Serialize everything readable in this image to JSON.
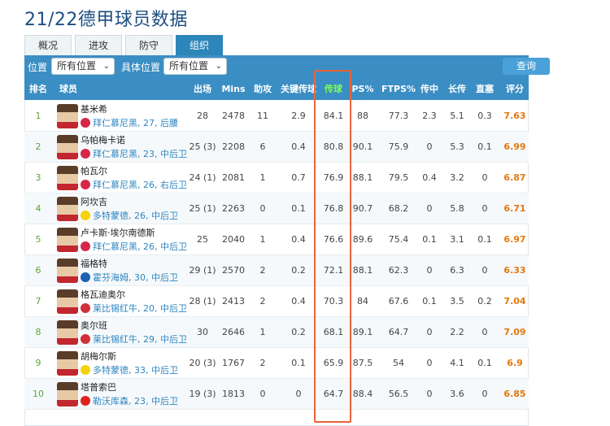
{
  "title": "21/22德甲球员数据",
  "tabs": [
    {
      "label": "概况"
    },
    {
      "label": "进攻"
    },
    {
      "label": "防守"
    },
    {
      "label": "组织"
    }
  ],
  "filters": {
    "position_label": "位置",
    "position_value": "所有位置",
    "detail_label": "具体位置",
    "detail_value": "所有位置",
    "query_label": "查询"
  },
  "columns": [
    "排名",
    "球员",
    "出场",
    "Mins",
    "助攻",
    "关键传球",
    "传球",
    "PS%",
    "FTPS%",
    "传中",
    "长传",
    "直塞",
    "评分"
  ],
  "club_colors": {
    "拜仁慕尼黑": "#d6264a",
    "多特蒙德": "#f5d20b",
    "霍芬海姆": "#1b62b5",
    "莱比锡红牛": "#d32e3b",
    "勒沃库森": "#e02020"
  },
  "players": [
    {
      "rank": "1",
      "name": "基米希",
      "info": "拜仁慕尼黑, 27, 后腰",
      "club": "拜仁慕尼黑",
      "apps": "28",
      "mins": "2478",
      "assists": "11",
      "key_passes": "2.9",
      "passes": "84.1",
      "ps": "88",
      "ftps": "77.3",
      "crosses": "2.3",
      "long": "5.1",
      "through": "0.3",
      "rating": "7.63"
    },
    {
      "rank": "2",
      "name": "乌帕梅卡诺",
      "info": "拜仁慕尼黑, 23, 中后卫",
      "club": "拜仁慕尼黑",
      "apps": "25 (3)",
      "mins": "2208",
      "assists": "6",
      "key_passes": "0.4",
      "passes": "80.8",
      "ps": "90.1",
      "ftps": "75.9",
      "crosses": "0",
      "long": "5.3",
      "through": "0.1",
      "rating": "6.99"
    },
    {
      "rank": "3",
      "name": "帕瓦尔",
      "info": "拜仁慕尼黑, 26, 右后卫",
      "club": "拜仁慕尼黑",
      "apps": "24 (1)",
      "mins": "2081",
      "assists": "1",
      "key_passes": "0.7",
      "passes": "76.9",
      "ps": "88.1",
      "ftps": "79.5",
      "crosses": "0.4",
      "long": "3.2",
      "through": "0",
      "rating": "6.87"
    },
    {
      "rank": "4",
      "name": "阿坎吉",
      "info": "多特蒙德, 26, 中后卫",
      "club": "多特蒙德",
      "apps": "25 (1)",
      "mins": "2263",
      "assists": "0",
      "key_passes": "0.1",
      "passes": "76.8",
      "ps": "90.7",
      "ftps": "68.2",
      "crosses": "0",
      "long": "5.8",
      "through": "0",
      "rating": "6.71"
    },
    {
      "rank": "5",
      "name": "卢卡斯·埃尔南德斯",
      "info": "拜仁慕尼黑, 26, 中后卫",
      "club": "拜仁慕尼黑",
      "apps": "25",
      "mins": "2040",
      "assists": "1",
      "key_passes": "0.4",
      "passes": "76.6",
      "ps": "89.6",
      "ftps": "75.4",
      "crosses": "0.1",
      "long": "3.1",
      "through": "0.1",
      "rating": "6.97"
    },
    {
      "rank": "6",
      "name": "福格特",
      "info": "霍芬海姆, 30, 中后卫",
      "club": "霍芬海姆",
      "apps": "29 (1)",
      "mins": "2570",
      "assists": "2",
      "key_passes": "0.2",
      "passes": "72.1",
      "ps": "88.1",
      "ftps": "62.3",
      "crosses": "0",
      "long": "6.3",
      "through": "0",
      "rating": "6.33"
    },
    {
      "rank": "7",
      "name": "格瓦迪奥尔",
      "info": "莱比锡红牛, 20, 中后卫",
      "club": "莱比锡红牛",
      "apps": "28 (1)",
      "mins": "2413",
      "assists": "2",
      "key_passes": "0.4",
      "passes": "70.3",
      "ps": "84",
      "ftps": "67.6",
      "crosses": "0.1",
      "long": "3.5",
      "through": "0.2",
      "rating": "7.04"
    },
    {
      "rank": "8",
      "name": "奥尔班",
      "info": "莱比锡红牛, 29, 中后卫",
      "club": "莱比锡红牛",
      "apps": "30",
      "mins": "2646",
      "assists": "1",
      "key_passes": "0.2",
      "passes": "68.1",
      "ps": "89.1",
      "ftps": "64.7",
      "crosses": "0",
      "long": "2.2",
      "through": "0",
      "rating": "7.09"
    },
    {
      "rank": "9",
      "name": "胡梅尔斯",
      "info": "多特蒙德, 33, 中后卫",
      "club": "多特蒙德",
      "apps": "20 (3)",
      "mins": "1767",
      "assists": "2",
      "key_passes": "0.1",
      "passes": "65.9",
      "ps": "87.5",
      "ftps": "54",
      "crosses": "0",
      "long": "4.1",
      "through": "0.1",
      "rating": "6.9"
    },
    {
      "rank": "10",
      "name": "塔普索巴",
      "info": "勒沃库森, 23, 中后卫",
      "club": "勒沃库森",
      "apps": "19 (3)",
      "mins": "1813",
      "assists": "0",
      "key_passes": "0",
      "passes": "64.7",
      "ps": "88.4",
      "ftps": "56.5",
      "crosses": "0",
      "long": "3.6",
      "through": "0",
      "rating": "6.85"
    }
  ]
}
